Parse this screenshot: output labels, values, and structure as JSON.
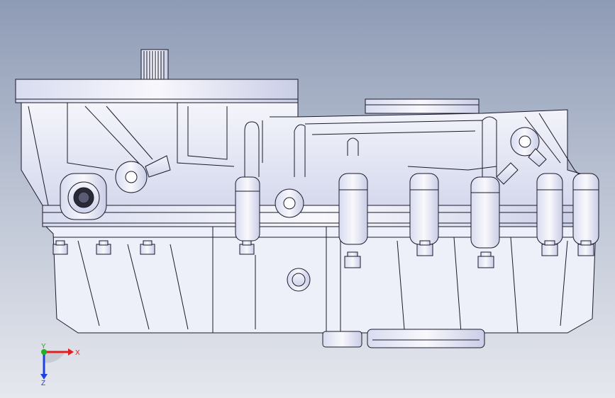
{
  "triad": {
    "x_label": "X",
    "y_label": "Y",
    "z_label": "Z",
    "x_color": "#e02020",
    "y_color": "#20b020",
    "z_color": "#2040e0"
  },
  "colors": {
    "background_top": "#8e9bb5",
    "background_bottom": "#e6e8ee",
    "edge": "#1a1a2a",
    "body_fill": "#eceef8",
    "shade_fill": "#c8cce8"
  }
}
